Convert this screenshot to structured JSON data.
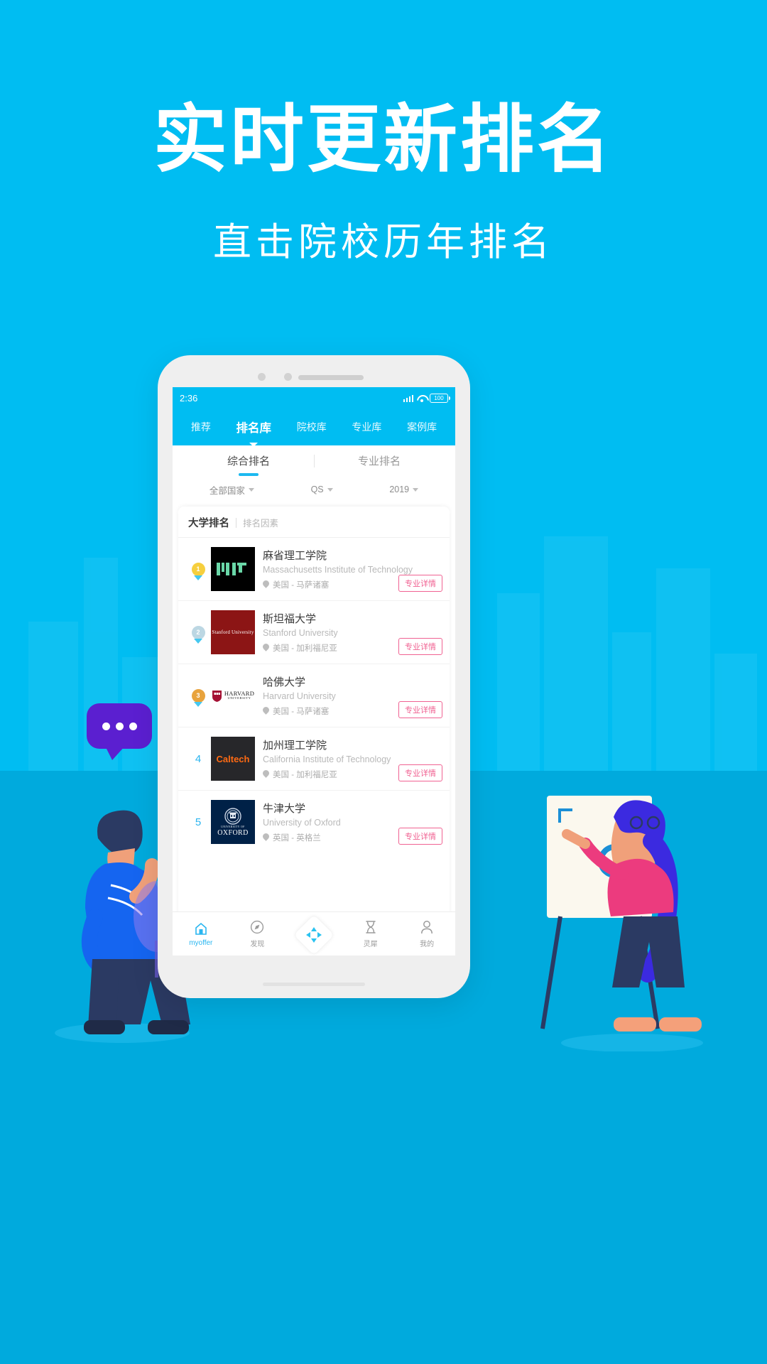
{
  "promo": {
    "headline": "实时更新排名",
    "subhead": "直击院校历年排名"
  },
  "colors": {
    "background_top": "#00bdf2",
    "background_bottom": "#00aadd",
    "accent": "#1cb9f0",
    "detail_button": "#f06292",
    "gold": "#f6cf3e",
    "silver": "#bcd7e3",
    "bronze": "#e8a33d"
  },
  "phone": {
    "status_bar": {
      "time": "2:36",
      "battery_text": "100",
      "signal_icon": "signal-bars-icon",
      "wifi_icon": "wifi-icon",
      "battery_icon": "battery-icon"
    },
    "main_tabs": [
      {
        "label": "推荐",
        "active": false
      },
      {
        "label": "排名库",
        "active": true
      },
      {
        "label": "院校库",
        "active": false
      },
      {
        "label": "专业库",
        "active": false
      },
      {
        "label": "案例库",
        "active": false
      }
    ],
    "sub_tabs": [
      {
        "label": "综合排名",
        "active": true
      },
      {
        "label": "专业排名",
        "active": false
      }
    ],
    "filters": [
      {
        "label": "全部国家",
        "icon": "chevron-down-icon"
      },
      {
        "label": "QS",
        "icon": "chevron-down-icon"
      },
      {
        "label": "2019",
        "icon": "chevron-down-icon"
      }
    ],
    "card_header": {
      "primary": "大学排名",
      "secondary": "排名因素"
    },
    "detail_button_label": "专业详情",
    "rankings": [
      {
        "rank": "1",
        "medal": "gold",
        "name_cn": "麻省理工学院",
        "name_en": "Massachusetts Institute of Technology",
        "location": "美国 - 马萨诸塞",
        "logo_text": "MIT"
      },
      {
        "rank": "2",
        "medal": "silver",
        "name_cn": "斯坦福大学",
        "name_en": "Stanford University",
        "location": "美国 - 加利福尼亚",
        "logo_text": "Stanford University"
      },
      {
        "rank": "3",
        "medal": "bronze",
        "name_cn": "哈佛大学",
        "name_en": "Harvard University",
        "location": "美国 - 马萨诸塞",
        "logo_text": "HARVARD",
        "logo_sub": "UNIVERSITY"
      },
      {
        "rank": "4",
        "medal": "none",
        "name_cn": "加州理工学院",
        "name_en": "California Institute of Technology",
        "location": "美国 - 加利福尼亚",
        "logo_text": "Caltech"
      },
      {
        "rank": "5",
        "medal": "none",
        "name_cn": "牛津大学",
        "name_en": "University of Oxford",
        "location": "英国 - 英格兰",
        "logo_text": "OXFORD",
        "logo_sub": "UNIVERSITY OF"
      }
    ],
    "bottom_nav": [
      {
        "label": "myoffer",
        "icon": "home-icon",
        "active": true
      },
      {
        "label": "发现",
        "icon": "compass-icon",
        "active": false
      },
      {
        "label": "",
        "icon": "arrows-fab-icon",
        "active": false
      },
      {
        "label": "灵犀",
        "icon": "hourglass-icon",
        "active": false
      },
      {
        "label": "我的",
        "icon": "person-icon",
        "active": false
      }
    ]
  }
}
